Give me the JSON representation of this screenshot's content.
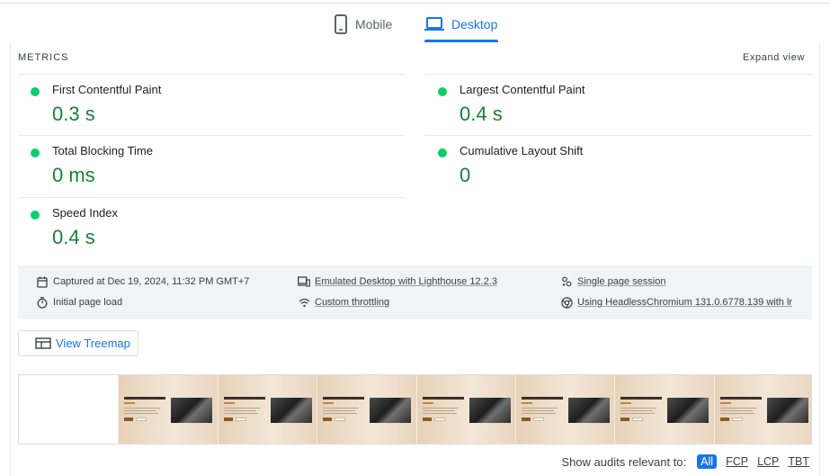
{
  "tabs": {
    "mobile": {
      "label": "Mobile",
      "icon": "smartphone-icon"
    },
    "desktop": {
      "label": "Desktop",
      "icon": "laptop-icon",
      "active": true
    }
  },
  "metrics": {
    "section_title": "METRICS",
    "expand_label": "Expand view",
    "items": [
      {
        "label": "First Contentful Paint",
        "value": "0.3 s",
        "status": "good"
      },
      {
        "label": "Largest Contentful Paint",
        "value": "0.4 s",
        "status": "good"
      },
      {
        "label": "Total Blocking Time",
        "value": "0 ms",
        "status": "good"
      },
      {
        "label": "Cumulative Layout Shift",
        "value": "0",
        "status": "good"
      },
      {
        "label": "Speed Index",
        "value": "0.4 s",
        "status": "good"
      }
    ]
  },
  "info": {
    "captured": "Captured at Dec 19, 2024, 11:32 PM GMT+7",
    "emulated": "Emulated Desktop with Lighthouse 12.2.3",
    "session": "Single page session",
    "load": "Initial page load",
    "throttling": "Custom throttling",
    "browser": "Using HeadlessChromium 131.0.6778.139 with lr"
  },
  "treemap": {
    "label": "View Treemap"
  },
  "filmstrip": {
    "frame_count": 8,
    "blank_frames": 1
  },
  "filters": {
    "label": "Show audits relevant to:",
    "chips": [
      "All",
      "FCP",
      "LCP",
      "TBT"
    ],
    "active": "All"
  },
  "colors": {
    "accent": "#1a73e8",
    "good": "#0cce6b",
    "good_text": "#188038"
  }
}
